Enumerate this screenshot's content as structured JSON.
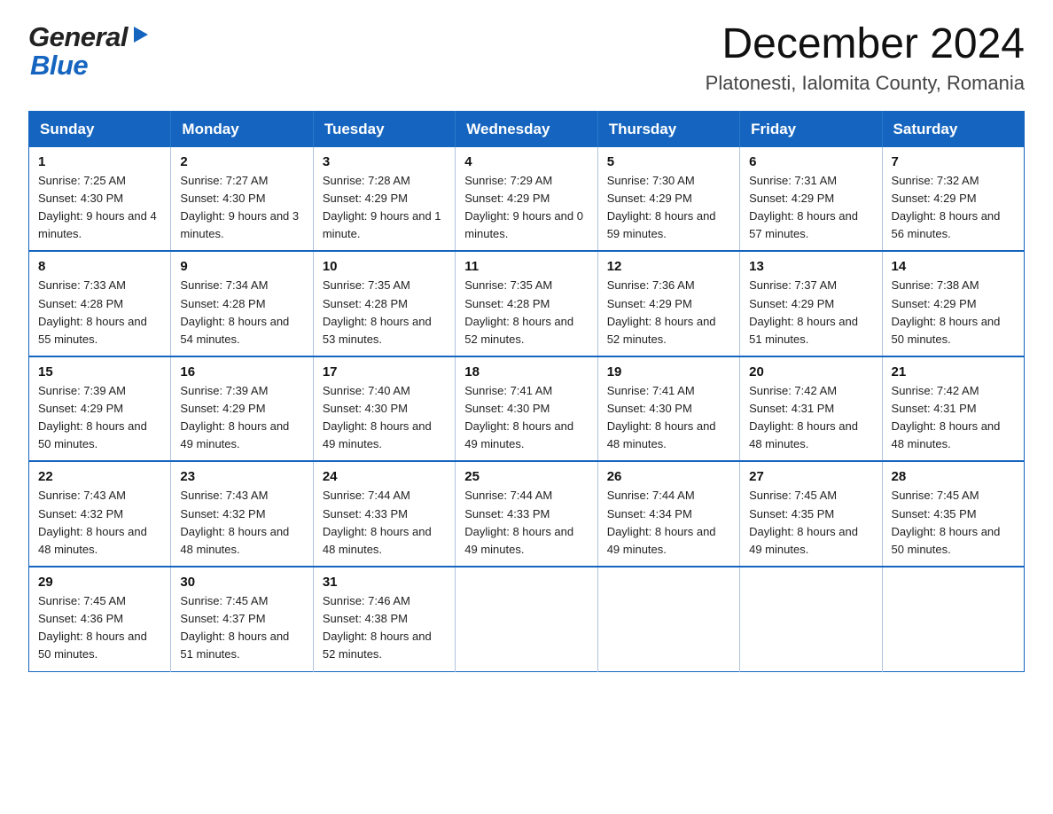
{
  "header": {
    "title": "December 2024",
    "subtitle": "Platonesti, Ialomita County, Romania",
    "logo_general": "General",
    "logo_blue": "Blue"
  },
  "calendar": {
    "days_of_week": [
      "Sunday",
      "Monday",
      "Tuesday",
      "Wednesday",
      "Thursday",
      "Friday",
      "Saturday"
    ],
    "weeks": [
      [
        {
          "day": 1,
          "sunrise": "7:25 AM",
          "sunset": "4:30 PM",
          "daylight": "9 hours and 4 minutes."
        },
        {
          "day": 2,
          "sunrise": "7:27 AM",
          "sunset": "4:30 PM",
          "daylight": "9 hours and 3 minutes."
        },
        {
          "day": 3,
          "sunrise": "7:28 AM",
          "sunset": "4:29 PM",
          "daylight": "9 hours and 1 minute."
        },
        {
          "day": 4,
          "sunrise": "7:29 AM",
          "sunset": "4:29 PM",
          "daylight": "9 hours and 0 minutes."
        },
        {
          "day": 5,
          "sunrise": "7:30 AM",
          "sunset": "4:29 PM",
          "daylight": "8 hours and 59 minutes."
        },
        {
          "day": 6,
          "sunrise": "7:31 AM",
          "sunset": "4:29 PM",
          "daylight": "8 hours and 57 minutes."
        },
        {
          "day": 7,
          "sunrise": "7:32 AM",
          "sunset": "4:29 PM",
          "daylight": "8 hours and 56 minutes."
        }
      ],
      [
        {
          "day": 8,
          "sunrise": "7:33 AM",
          "sunset": "4:28 PM",
          "daylight": "8 hours and 55 minutes."
        },
        {
          "day": 9,
          "sunrise": "7:34 AM",
          "sunset": "4:28 PM",
          "daylight": "8 hours and 54 minutes."
        },
        {
          "day": 10,
          "sunrise": "7:35 AM",
          "sunset": "4:28 PM",
          "daylight": "8 hours and 53 minutes."
        },
        {
          "day": 11,
          "sunrise": "7:35 AM",
          "sunset": "4:28 PM",
          "daylight": "8 hours and 52 minutes."
        },
        {
          "day": 12,
          "sunrise": "7:36 AM",
          "sunset": "4:29 PM",
          "daylight": "8 hours and 52 minutes."
        },
        {
          "day": 13,
          "sunrise": "7:37 AM",
          "sunset": "4:29 PM",
          "daylight": "8 hours and 51 minutes."
        },
        {
          "day": 14,
          "sunrise": "7:38 AM",
          "sunset": "4:29 PM",
          "daylight": "8 hours and 50 minutes."
        }
      ],
      [
        {
          "day": 15,
          "sunrise": "7:39 AM",
          "sunset": "4:29 PM",
          "daylight": "8 hours and 50 minutes."
        },
        {
          "day": 16,
          "sunrise": "7:39 AM",
          "sunset": "4:29 PM",
          "daylight": "8 hours and 49 minutes."
        },
        {
          "day": 17,
          "sunrise": "7:40 AM",
          "sunset": "4:30 PM",
          "daylight": "8 hours and 49 minutes."
        },
        {
          "day": 18,
          "sunrise": "7:41 AM",
          "sunset": "4:30 PM",
          "daylight": "8 hours and 49 minutes."
        },
        {
          "day": 19,
          "sunrise": "7:41 AM",
          "sunset": "4:30 PM",
          "daylight": "8 hours and 48 minutes."
        },
        {
          "day": 20,
          "sunrise": "7:42 AM",
          "sunset": "4:31 PM",
          "daylight": "8 hours and 48 minutes."
        },
        {
          "day": 21,
          "sunrise": "7:42 AM",
          "sunset": "4:31 PM",
          "daylight": "8 hours and 48 minutes."
        }
      ],
      [
        {
          "day": 22,
          "sunrise": "7:43 AM",
          "sunset": "4:32 PM",
          "daylight": "8 hours and 48 minutes."
        },
        {
          "day": 23,
          "sunrise": "7:43 AM",
          "sunset": "4:32 PM",
          "daylight": "8 hours and 48 minutes."
        },
        {
          "day": 24,
          "sunrise": "7:44 AM",
          "sunset": "4:33 PM",
          "daylight": "8 hours and 48 minutes."
        },
        {
          "day": 25,
          "sunrise": "7:44 AM",
          "sunset": "4:33 PM",
          "daylight": "8 hours and 49 minutes."
        },
        {
          "day": 26,
          "sunrise": "7:44 AM",
          "sunset": "4:34 PM",
          "daylight": "8 hours and 49 minutes."
        },
        {
          "day": 27,
          "sunrise": "7:45 AM",
          "sunset": "4:35 PM",
          "daylight": "8 hours and 49 minutes."
        },
        {
          "day": 28,
          "sunrise": "7:45 AM",
          "sunset": "4:35 PM",
          "daylight": "8 hours and 50 minutes."
        }
      ],
      [
        {
          "day": 29,
          "sunrise": "7:45 AM",
          "sunset": "4:36 PM",
          "daylight": "8 hours and 50 minutes."
        },
        {
          "day": 30,
          "sunrise": "7:45 AM",
          "sunset": "4:37 PM",
          "daylight": "8 hours and 51 minutes."
        },
        {
          "day": 31,
          "sunrise": "7:46 AM",
          "sunset": "4:38 PM",
          "daylight": "8 hours and 52 minutes."
        },
        null,
        null,
        null,
        null
      ]
    ]
  }
}
